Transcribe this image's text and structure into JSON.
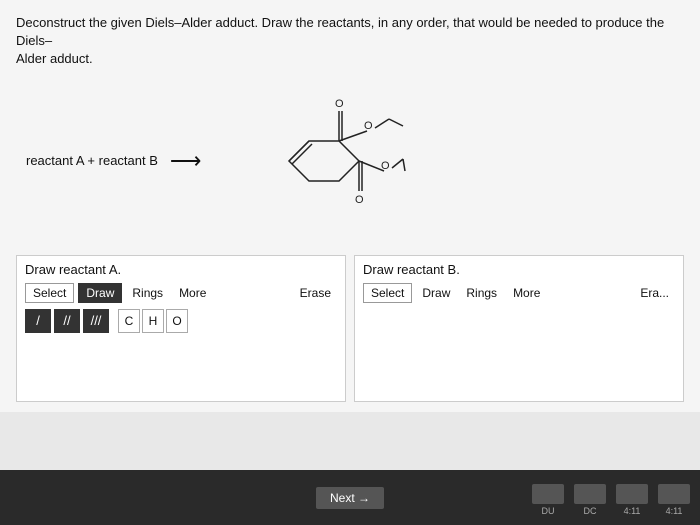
{
  "instruction": {
    "line1": "Deconstruct the given Diels–Alder adduct. Draw the reactants, in any order, that would be needed to produce the Diels–",
    "line2": "Alder adduct."
  },
  "reaction": {
    "label": "reactant A + reactant B"
  },
  "panel_a": {
    "title": "Draw reactant A.",
    "select_label": "Select",
    "draw_label": "Draw",
    "rings_label": "Rings",
    "more_label": "More",
    "erase_label": "Erase",
    "bond_single": "/",
    "bond_double": "//",
    "bond_triple": "///",
    "atom_c": "C",
    "atom_h": "H",
    "atom_o": "O"
  },
  "panel_b": {
    "title": "Draw reactant B.",
    "select_label": "Select",
    "draw_label": "Draw",
    "rings_label": "Rings",
    "more_label": "More",
    "erase_label": "Era..."
  },
  "bottom": {
    "next_label": "Next →"
  }
}
